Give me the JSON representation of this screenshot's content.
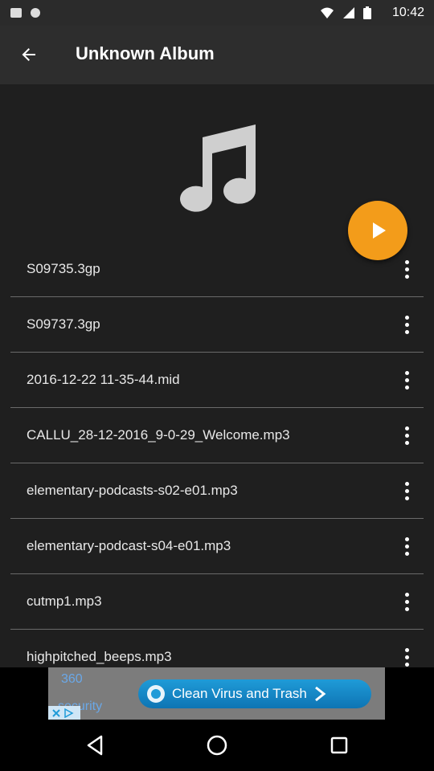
{
  "status": {
    "time": "10:42"
  },
  "appbar": {
    "title": "Unknown Album"
  },
  "colors": {
    "accent": "#f39c1a",
    "appbar": "#2d2d2d",
    "content_bg": "#1f1f1f"
  },
  "tracks": [
    {
      "label": "S09735.3gp"
    },
    {
      "label": "S09737.3gp"
    },
    {
      "label": "2016-12-22 11-35-44.mid"
    },
    {
      "label": "CALLU_28-12-2016_9-0-29_Welcome.mp3"
    },
    {
      "label": "elementary-podcasts-s02-e01.mp3"
    },
    {
      "label": "elementary-podcast-s04-e01.mp3"
    },
    {
      "label": "cutmp1.mp3"
    },
    {
      "label": "highpitched_beeps.mp3"
    }
  ],
  "ad": {
    "line1": "360",
    "line2": "security",
    "button_label": "Clean Virus and Trash"
  },
  "icons": {
    "back": "arrow-left-icon",
    "art": "music-note-icon",
    "play": "play-icon",
    "menu": "more-vert-icon",
    "nav_back": "triangle-back-icon",
    "nav_home": "circle-home-icon",
    "nav_recents": "square-recents-icon"
  }
}
